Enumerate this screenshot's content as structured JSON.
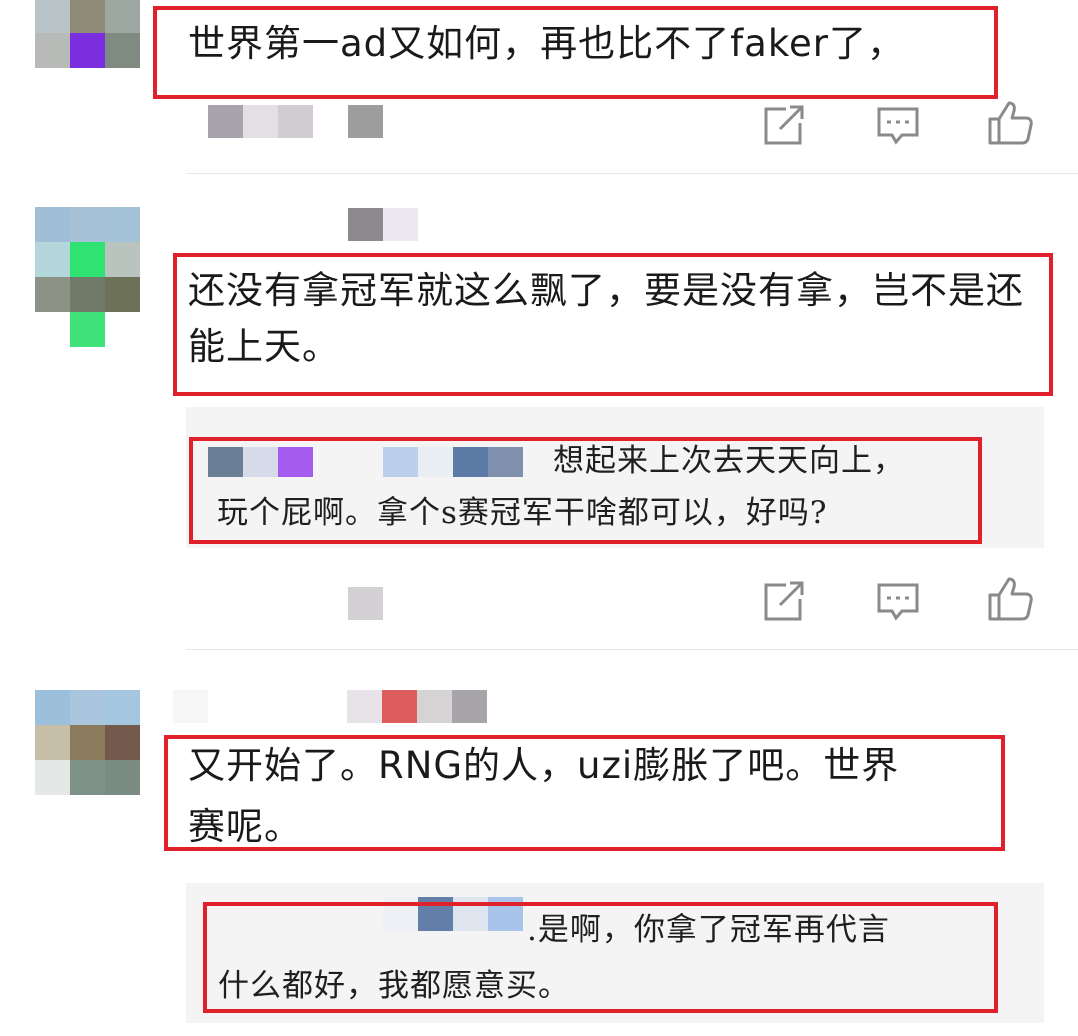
{
  "colors": {
    "highlight_border": "#e0212c",
    "reply_background": "#f4f4f4",
    "icon_stroke": "#8a8a8a"
  },
  "icons": [
    "share-icon",
    "comment-icon",
    "like-icon"
  ],
  "comments": [
    {
      "text": "世界第一ad又如何，再也比不了faker了，"
    },
    {
      "text": "还没有拿冠军就这么飘了，要是没有拿，岂不是还能上天。",
      "reply": {
        "text_line1": "想起来上次去天天向上，",
        "text_line2": "玩个屁啊。拿个s赛冠军干啥都可以，好吗?"
      }
    },
    {
      "text_line1": "又开始了。RNG的人，uzi膨胀了吧。世界",
      "text_line2": "赛呢。",
      "reply": {
        "text_line1": ".是啊，你拿了冠军再代言",
        "text_line2": "什么都好，我都愿意买。"
      }
    }
  ]
}
